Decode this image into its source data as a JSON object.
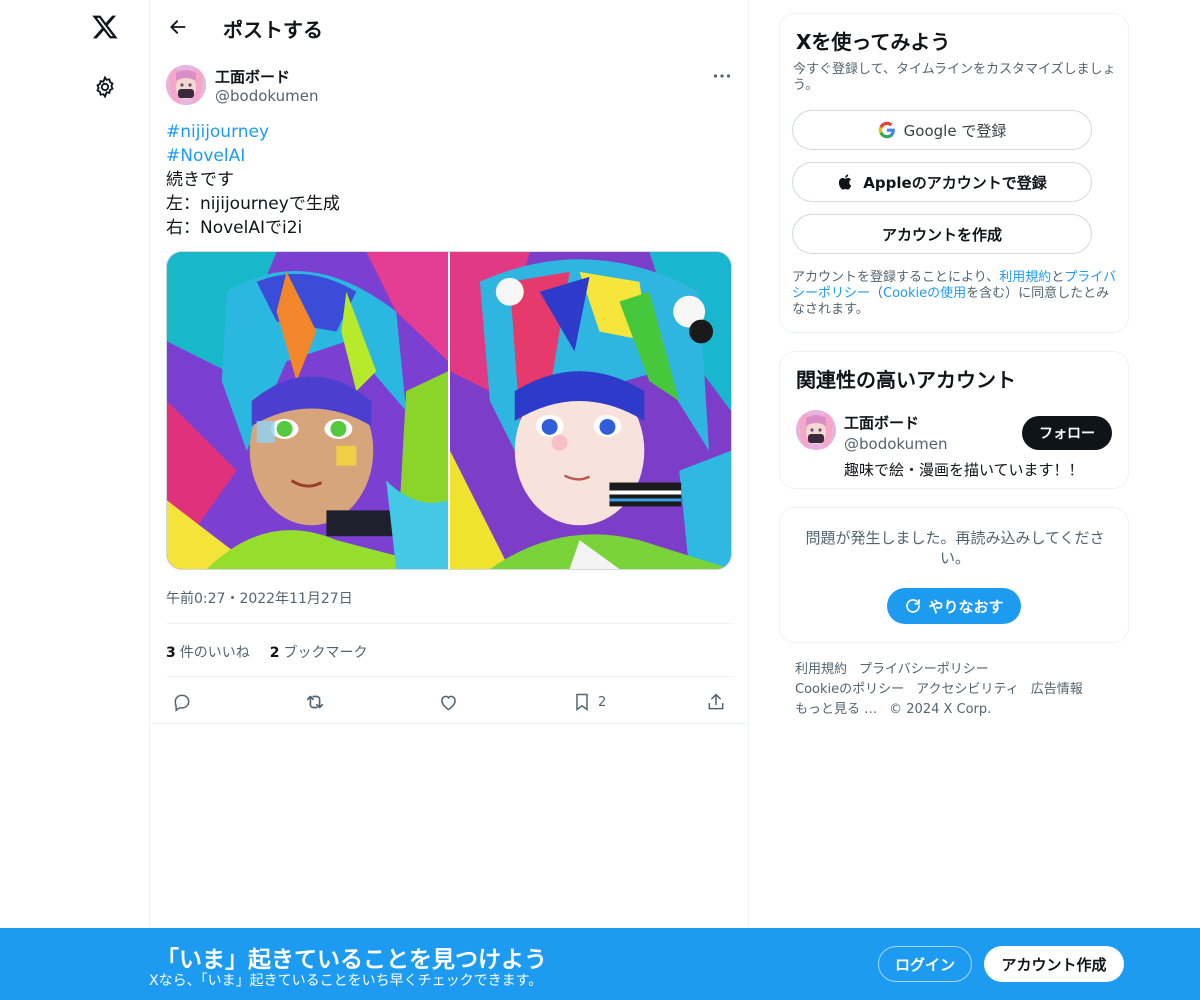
{
  "nav": {
    "logo_icon": "x-logo-icon",
    "settings_icon": "gear-icon"
  },
  "header": {
    "back_icon": "arrow-left-icon",
    "title": "ポストする"
  },
  "tweet": {
    "author_name": "工面ボード",
    "author_handle": "@bodokumen",
    "more_icon": "more-horizontal-icon",
    "lines": [
      {
        "text": "#nijijourney",
        "hashtag": true
      },
      {
        "text": "#NovelAI",
        "hashtag": true
      },
      {
        "text": "続きです",
        "hashtag": false
      },
      {
        "text": "左：nijijourneyで生成",
        "hashtag": false
      },
      {
        "text": "右：NovelAIでi2i",
        "hashtag": false
      }
    ],
    "timestamp": "午前0:27・2022年11月27日",
    "likes_count": "3",
    "likes_label": "件のいいね",
    "bookmarks_count": "2",
    "bookmarks_label": "ブックマーク",
    "actions": {
      "reply_icon": "reply-icon",
      "repost_icon": "repost-icon",
      "like_icon": "heart-icon",
      "bookmark_icon": "bookmark-icon",
      "bookmark_count": "2",
      "share_icon": "share-icon"
    }
  },
  "signup": {
    "title": "Xを使ってみよう",
    "subtitle": "今すぐ登録して、タイムラインをカスタマイズしましょう。",
    "google_label": "Google で登録",
    "apple_label": "Appleのアカウントで登録",
    "create_label": "アカウントを作成",
    "terms_prefix": "アカウントを登録することにより、",
    "terms_link": "利用規約",
    "terms_and": "と",
    "privacy_link": "プライバシーポリシー",
    "cookie_open": "（",
    "cookie_link": "Cookieの使用",
    "terms_suffix": "を含む）に同意したとみなされます。"
  },
  "relevant": {
    "title": "関連性の高いアカウント",
    "name": "工面ボード",
    "handle": "@bodokumen",
    "bio": "趣味で絵・漫画を描いています！！",
    "follow_label": "フォロー"
  },
  "error": {
    "message": "問題が発生しました。再読み込みしてください。",
    "retry_label": "やりなおす"
  },
  "footer": {
    "links": [
      "利用規約",
      "プライバシーポリシー",
      "Cookieのポリシー",
      "アクセシビリティ",
      "広告情報",
      "もっと見る …",
      "© 2024 X Corp."
    ]
  },
  "banner": {
    "title": "「いま」起きていることを見つけよう",
    "subtitle": "Xなら、「いま」起きていることをいち早くチェックできます。",
    "login_label": "ログイン",
    "create_label": "アカウント作成"
  },
  "colors": {
    "accent": "#1d9bf0",
    "text": "#0f1419",
    "muted": "#536471"
  }
}
